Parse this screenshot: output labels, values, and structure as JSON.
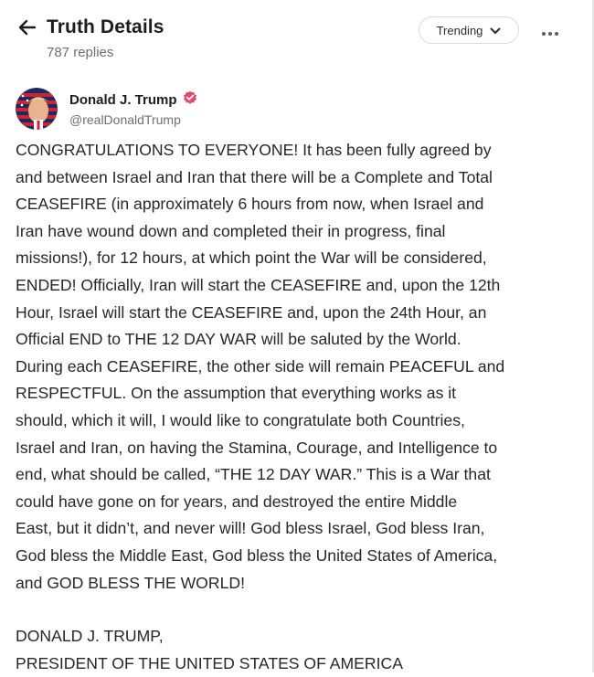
{
  "header": {
    "title": "Truth Details",
    "replies": "787 replies",
    "sort_label": "Trending",
    "back_icon": "arrow-left-icon",
    "more_icon": "more-horizontal-icon"
  },
  "post": {
    "author_name": "Donald J. Trump",
    "handle": "@realDonaldTrump",
    "verified_color": "#e4486b",
    "lines": [
      "CONGRATULATIONS TO EVERYONE! It has been fully agreed by",
      "and between Israel and Iran that there will be a Complete and Total",
      "CEASEFIRE (in approximately 6 hours from now, when Israel and",
      "Iran have wound down and completed their in progress, final",
      "missions!), for 12 hours, at which point the War will be considered,",
      "ENDED! Officially, Iran will start the CEASEFIRE and, upon the 12th",
      "Hour, Israel will start the CEASEFIRE and, upon the 24th Hour, an",
      "Official END to THE 12 DAY WAR will be saluted by the World.",
      "During each CEASEFIRE, the other side will remain PEACEFUL and",
      "RESPECTFUL. On the assumption that everything works as it",
      "should, which it will, I would like to congratulate both Countries,",
      "Israel and Iran, on having the Stamina, Courage, and Intelligence to",
      "end, what should be called, “THE 12 DAY WAR.” This is a War that",
      "could have gone on for years, and destroyed the entire Middle",
      "East, but it didn’t, and never will! God bless Israel, God bless Iran,",
      "God bless the Middle East, God bless the United States of America,",
      "and GOD BLESS THE WORLD!"
    ],
    "signature_line1": "DONALD J. TRUMP,",
    "signature_line2": "PRESIDENT OF THE UNITED STATES OF AMERICA"
  }
}
